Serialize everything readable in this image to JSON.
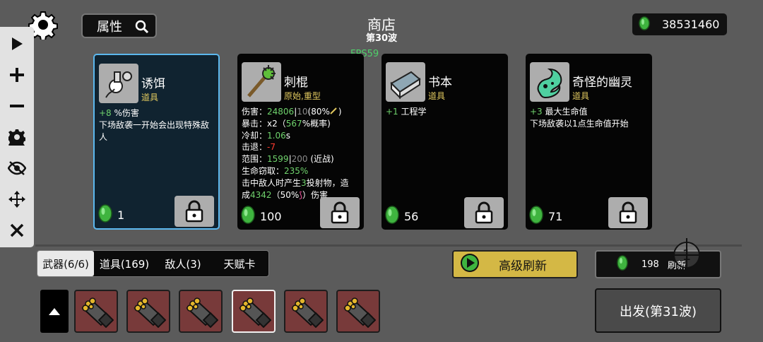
{
  "header": {
    "attr_label": "属性",
    "title": "商店",
    "wave": "第30波",
    "money": "38531460",
    "fps": "FPS59"
  },
  "toolbar": {
    "items": [
      "play-icon",
      "plus-icon",
      "minus-icon",
      "gear-icon",
      "eye-off-icon",
      "move-icon",
      "close-icon"
    ]
  },
  "cards": [
    {
      "name": "诱饵",
      "type": "道具",
      "price": "1",
      "desc1_val": "+8",
      "desc1_rest": " %伤害",
      "desc2": "下场敌袭一开始会出现特殊敌人"
    },
    {
      "name": "刺棍",
      "type": "原始,重型",
      "price": "100",
      "stats": {
        "damage_label": "伤害：",
        "damage_val": "24806",
        "damage_sep": "|",
        "damage_base": "10",
        "damage_rest": "(80%",
        "crit_label": "暴击：",
        "crit_mult": "x2",
        "crit_open": "（",
        "crit_pct": "567",
        "crit_rest": "%概率)",
        "cooldown_label": "冷却：",
        "cooldown_val": "1.06",
        "cooldown_unit": "s",
        "knockback_label": "击退：",
        "knockback_val": "-7",
        "range_label": "范围：",
        "range_val": "1599",
        "range_sep": "|",
        "range_base": "200",
        "range_rest": " (近战)",
        "lifesteal_label": "生命窃取：",
        "lifesteal_val": "235%",
        "effect1": "击中敌人时产生",
        "effect_num": "3",
        "effect2": "投射物，造",
        "effect3": "成",
        "effect_dmg": "4342",
        "effect4": "（50%",
        "effect5": "）伤害"
      }
    },
    {
      "name": "书本",
      "type": "道具",
      "price": "56",
      "desc1_val": "+1",
      "desc1_rest": " 工程学"
    },
    {
      "name": "奇怪的幽灵",
      "type": "道具",
      "price": "71",
      "desc1_val": "+3",
      "desc1_rest": " 最大生命值",
      "desc2": "下场敌袭以1点生命值开始"
    }
  ],
  "tabs": [
    "武器(6/6)",
    "道具(169)",
    "敌人(3)",
    "天赋卡"
  ],
  "buttons": {
    "advanced_refresh": "高级刷新",
    "refresh_cost": "198",
    "refresh_label": "刷新",
    "refresh_overlay": "1",
    "go": "出发(第31波)"
  },
  "colors": {
    "accent_green": "#6fd26c",
    "gold": "#d4b845",
    "type_yellow": "#e0c85e",
    "slot_red": "#783a3a",
    "selected_border": "#5cb8ee"
  }
}
